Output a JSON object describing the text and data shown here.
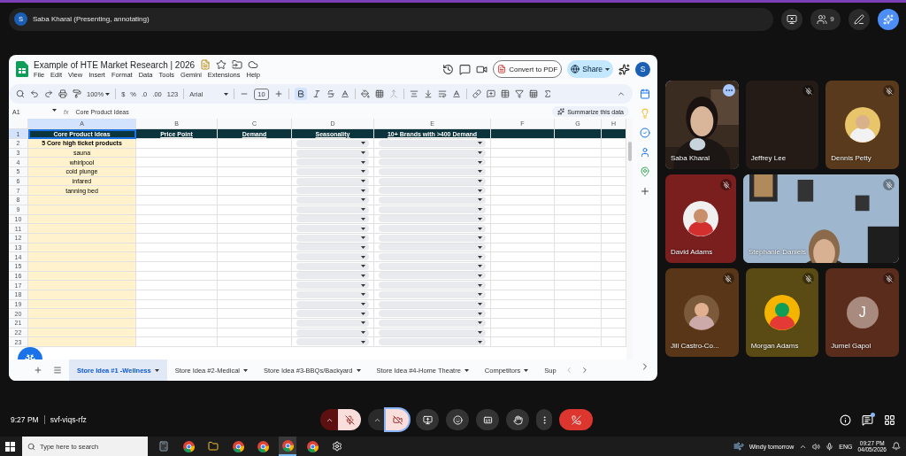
{
  "presenter_bar": {
    "avatar": "S",
    "label": "Saba Kharal (Presenting, annotating)",
    "participant_count": "9"
  },
  "sheet": {
    "title": "Example of HTE Market Research | 2026",
    "menus": [
      "File",
      "Edit",
      "View",
      "Insert",
      "Format",
      "Data",
      "Tools",
      "Gemini",
      "Extensions",
      "Help"
    ],
    "convert_button": "Convert to PDF",
    "share_button": "Share",
    "account_avatar": "S",
    "toolbar": {
      "zoom": "100%",
      "currency": "$",
      "percent": "%",
      "decrease_decimals": ".0",
      "increase_decimals": ".00",
      "number_format": "123",
      "font": "Arial",
      "font_size": "10",
      "bold_active": true
    },
    "name_box": "A1",
    "formula_symbol": "fx",
    "formula": "Core Product Ideas",
    "header_row_number": "1",
    "summarize_button": "Summarize this data",
    "columns": [
      {
        "letter": "A",
        "highlight": true
      },
      {
        "letter": "B"
      },
      {
        "letter": "C"
      },
      {
        "letter": "D",
        "dropdowns": true
      },
      {
        "letter": "E",
        "dropdowns": true
      },
      {
        "letter": "F"
      },
      {
        "letter": "G"
      },
      {
        "letter": "H"
      }
    ],
    "header_row": [
      "Core Product Ideas",
      "Price Point",
      "Demand",
      "Seasonality",
      "10+ Brands with >400 Demand"
    ],
    "rows": [
      {
        "number": "2",
        "cells": [
          "5 Core high ticket products"
        ],
        "bold": true
      },
      {
        "number": "3",
        "cells": [
          "sauna"
        ],
        "bold": false
      },
      {
        "number": "4",
        "cells": [
          "whirlpool"
        ],
        "bold": false
      },
      {
        "number": "5",
        "cells": [
          "cold plunge"
        ],
        "bold": false
      },
      {
        "number": "6",
        "cells": [
          "infared"
        ],
        "bold": false
      },
      {
        "number": "7",
        "cells": [
          "tanning bed"
        ],
        "bold": false
      },
      {
        "number": "8"
      },
      {
        "number": "9"
      },
      {
        "number": "10"
      },
      {
        "number": "11"
      },
      {
        "number": "12"
      },
      {
        "number": "13"
      },
      {
        "number": "14"
      },
      {
        "number": "15"
      },
      {
        "number": "16"
      },
      {
        "number": "17"
      },
      {
        "number": "18"
      },
      {
        "number": "19"
      },
      {
        "number": "20"
      },
      {
        "number": "21"
      },
      {
        "number": "22"
      },
      {
        "number": "23"
      }
    ],
    "tabs": [
      {
        "label": "Store Idea #1 -Wellness",
        "selected": true
      },
      {
        "label": "Store Idea #2-Medical",
        "selected": false
      },
      {
        "label": "Store Idea #3-BBQs/Backyard",
        "selected": false
      },
      {
        "label": "Store Idea #4-Home Theatre",
        "selected": false
      },
      {
        "label": "Competitors",
        "selected": false
      },
      {
        "label": "Sup",
        "selected": false
      }
    ]
  },
  "participant_rows": [
    [
      {
        "name": "Saba Kharal",
        "kind": "video",
        "muted": false,
        "highlighted": true,
        "color": "#3a2a20"
      },
      {
        "name": "Jeffrey Lee",
        "kind": "blank",
        "muted": true,
        "highlighted": false,
        "color": "#241b17"
      },
      {
        "name": "Dennis Petty",
        "kind": "avatar",
        "muted": true,
        "highlighted": false,
        "color": "#5a3a1c"
      }
    ],
    [
      {
        "name": "David Adams",
        "kind": "avatar",
        "muted": true,
        "highlighted": false,
        "color": "#7a1e1e"
      },
      {
        "name": "Stephanie Daniels",
        "kind": "video",
        "muted": true,
        "highlighted": false,
        "spotlight": true,
        "color": "#8fa6c0"
      }
    ],
    [
      {
        "name": "Jill Castro-Co...",
        "kind": "avatar",
        "muted": true,
        "highlighted": false,
        "color": "#5a3618"
      },
      {
        "name": "Morgan Adams",
        "kind": "avatar",
        "muted": true,
        "highlighted": false,
        "color": "#5a4a14"
      },
      {
        "name": "Jumel Gapol",
        "kind": "initial",
        "initial": "J",
        "muted": true,
        "highlighted": false,
        "color": "#5a2c1c"
      }
    ]
  ],
  "meet_bar": {
    "time": "9:27 PM",
    "meeting_code": "svf-viqs-rfz",
    "mic_on": false,
    "camera_on": false,
    "chat_unread": true
  },
  "taskbar": {
    "search_placeholder": "Type here to search",
    "weather": "Windy tomorrow",
    "language": "ENG",
    "time": "09:27 PM",
    "date": "04/05/2026"
  }
}
